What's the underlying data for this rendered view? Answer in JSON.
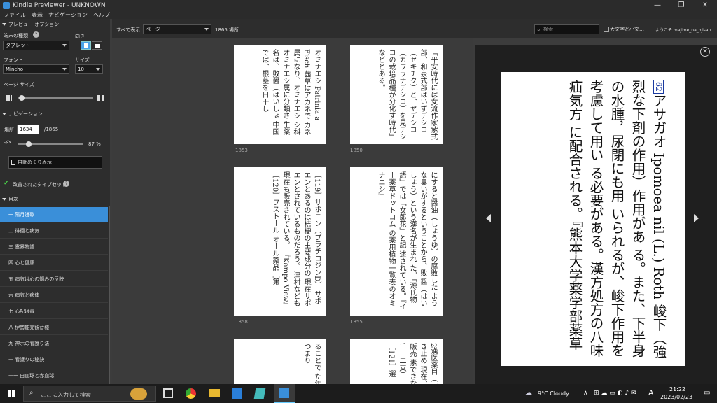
{
  "window": {
    "title": "Kindle Previewer - UNKNOWN",
    "minimize": "—",
    "maximize": "❐",
    "close": "✕"
  },
  "menu": [
    "ファイル",
    "表示",
    "ナビゲーション",
    "ヘルプ"
  ],
  "sidebar": {
    "preview_options": "プレビュー オプション",
    "device_type_label": "端末の種類",
    "help_icon": "?",
    "orientation_label": "向き",
    "device_value": "タブレット",
    "font_label": "フォント",
    "size_label": "サイズ",
    "font_value": "Mincho",
    "size_value": "10",
    "page_size_label": "ページ サイズ",
    "navigation": "ナビゲーション",
    "location_label": "場所",
    "location_value": "1634",
    "location_total": "/1865",
    "progress_percent": "87 %",
    "progress_fraction": 0.87,
    "autoflip": "自動めくり表示",
    "typeset": "改善されたタイプセット",
    "toc_header": "目次",
    "toc": [
      "一 陽月漫歌",
      "二 徘徊と病気",
      "三 霊界物語",
      "四 心と健康",
      "五 病気は心の悩みの反映",
      "六 病気と病体",
      "七 心配は毒",
      "八 伊勢能売観音様",
      "九 神示の看護り法",
      "十 看護りの秘訣",
      "十一 白血球と赤血球"
    ]
  },
  "topbar": {
    "view_label": "すべて表示",
    "view_value": "ページ",
    "locations": "1865 場所",
    "search_placeholder": "検索",
    "case_option": "大文字と小文…",
    "welcome": "ようこそ majime_na_ojisan"
  },
  "thumbs": [
    {
      "text": "「平安時代には女流作家紫式部、和泉式部はいずデシコ（セキチク）と、ヤデシコ（カワラナデシコ）を見デシコの栽培品種が分化す時代」などとある。",
      "num": "1850"
    },
    {
      "text": "オミナエシ Patrinia a Fisch 茜草はアカネで カネ属になり、オミナエシ シ科オミナエシ属に分類さ 生薬名は、敗醤（はいしょ 中国では、根茎を日干し",
      "num": "1853"
    },
    {
      "text": "にすると醤油（しょうゆ）の腐敗した ような臭いがするということから、敗 醤（はいしょう）という漢名が生まれ た。「源氏物語」では「女郎花」と記 述されている。『イー薬草ドットコム の薬用植物一覧表のオミナエシ』",
      "num": "1855"
    },
    {
      "text": "［119］サポニン（プラチコジンD） サポエンとあるのは桔梗の主要成分の 現在サポエンとされているものだろう。 津村なども現在も販売されている。 『Kampo View』［120］フストール オール薬品［第",
      "num": "1858"
    },
    {
      "text": "2漢医薬目（せき止め 現在、販売 素できな 千十二支）［121］選",
      "num": ""
    },
    {
      "text": "ることで た年つまり",
      "num": ""
    }
  ],
  "preview_text": {
    "marker": "62",
    "body": "アサガオ Ipomoea nil (L.) Roth 峻下（強烈な下剤の作用）作用があ る。また、下半身の水腫，尿閉にも用 いられるが、峻下作用を考慮して用い る必要がある。漢方処方の八味疝気方 に配合される。『熊本大学薬学部薬草"
  },
  "taskbar": {
    "search_placeholder": "ここに入力して検索",
    "weather": "9°C  Cloudy",
    "ime": "A",
    "time": "21:22",
    "date": "2023/02/23"
  }
}
